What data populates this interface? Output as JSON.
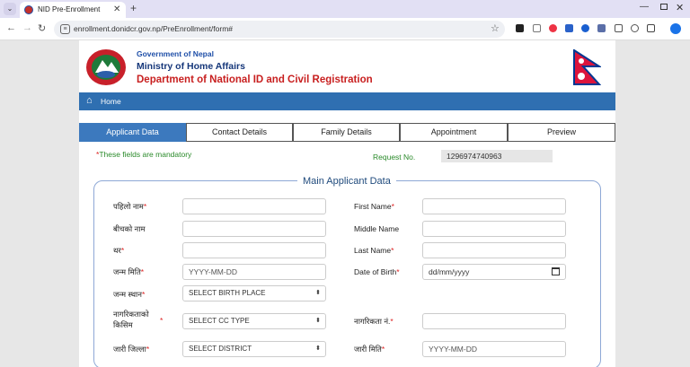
{
  "browser": {
    "tab_title": "NID Pre-Enrollment",
    "url": "enrollment.donidcr.gov.np/PreEnrollment/form#"
  },
  "header": {
    "gov": "Government of Nepal",
    "ministry": "Ministry of Home Affairs",
    "department": "Department of National ID and Civil Registration"
  },
  "nav": {
    "home": "Home"
  },
  "tabs": [
    {
      "label": "Applicant Data",
      "active": true
    },
    {
      "label": "Contact Details",
      "active": false
    },
    {
      "label": "Family Details",
      "active": false
    },
    {
      "label": "Appointment",
      "active": false
    },
    {
      "label": "Preview",
      "active": false
    }
  ],
  "form": {
    "mandatory_note": "These fields are mandatory",
    "request_label": "Request No.",
    "request_value": "1296974740963",
    "section_title": "Main Applicant Data",
    "first_name_np": "पहिलो नाम",
    "first_name_en": "First Name",
    "middle_name_np": "बीचको नाम",
    "middle_name_en": "Middle Name",
    "last_name_np": "थर",
    "last_name_en": "Last Name",
    "dob_np": "जन्म मिति",
    "dob_np_placeholder": "YYYY-MM-DD",
    "dob_en": "Date of Birth",
    "dob_en_placeholder": "dd/mm/yyyy",
    "birth_place_np": "जन्म स्थान",
    "birth_place_select": "SELECT BIRTH PLACE",
    "cc_type_np_line1": "नागरिकताको",
    "cc_type_np_line2": "किसिम",
    "cc_type_select": "SELECT CC TYPE",
    "cc_no_np": "नागरिकता नं.",
    "issue_district_np": "जारी जिल्ला",
    "issue_district_select": "SELECT DISTRICT",
    "issue_date_np": "जारी मिति",
    "issue_date_placeholder": "YYYY-MM-DD"
  },
  "colors": {
    "primary_blue": "#3c79be",
    "home_bar": "#2f6fb1",
    "required_red": "#d22222",
    "green_text": "#2a8a2a"
  }
}
